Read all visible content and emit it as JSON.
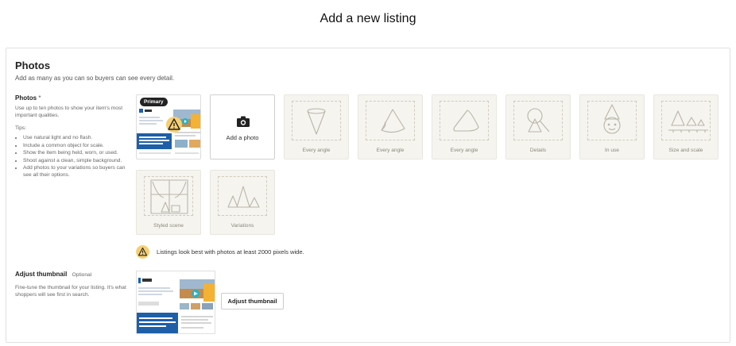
{
  "page": {
    "title": "Add a new listing"
  },
  "photos_section": {
    "title": "Photos",
    "subtitle": "Add as many as you can so buyers can see every detail.",
    "field_label": "Photos",
    "required_mark": "*",
    "description": "Use up to ten photos to show your item's most important qualities.",
    "tips_label": "Tips:",
    "tips": [
      "Use natural light and no flash.",
      "Include a common object for scale.",
      "Show the item being held, worn, or used.",
      "Shoot against a clean, simple background.",
      "Add photos to your variations so buyers can see all their options."
    ],
    "primary_badge": "Primary",
    "add_photo_label": "Add a photo",
    "slots": [
      {
        "label": "Every angle",
        "icon": "cone-icon"
      },
      {
        "label": "Every angle",
        "icon": "cone-side-icon"
      },
      {
        "label": "Every angle",
        "icon": "cone-flat-icon"
      },
      {
        "label": "Details",
        "icon": "magnifier-cone-icon"
      },
      {
        "label": "In use",
        "icon": "face-cone-icon"
      },
      {
        "label": "Size and scale",
        "icon": "ruler-cones-icon"
      },
      {
        "label": "Styled scene",
        "icon": "window-scene-icon"
      },
      {
        "label": "Variations",
        "icon": "three-cones-icon"
      }
    ],
    "warning": "Listings look best with photos at least 2000 pixels wide.",
    "colors": {
      "warning": "#f6cf72",
      "slot_bg": "#f5f4ef",
      "primary_badge": "#222222"
    }
  },
  "thumbnail_section": {
    "label": "Adjust thumbnail",
    "optional": "Optional",
    "description": "Fine-tune the thumbnail for your listing. It's what shoppers will see first in search.",
    "button": "Adjust thumbnail"
  }
}
